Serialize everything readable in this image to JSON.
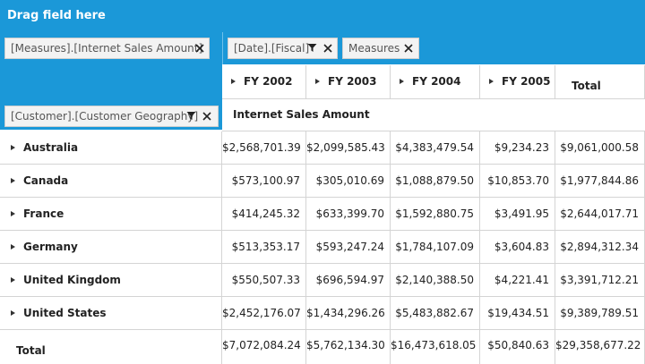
{
  "drag_bar": {
    "label": "Drag field here"
  },
  "values_area": {
    "pill": "[Measures].[Internet Sales Amount]"
  },
  "columns_area": {
    "pills": [
      "[Date].[Fiscal]",
      "Measures"
    ]
  },
  "rows_area": {
    "pill": "[Customer].[Customer Geography]"
  },
  "column_headers": [
    "FY 2002",
    "FY 2003",
    "FY 2004",
    "FY 2005",
    "Total"
  ],
  "measure_label": "Internet Sales Amount",
  "rows": [
    {
      "label": "Australia",
      "values": [
        "$2,568,701.39",
        "$2,099,585.43",
        "$4,383,479.54",
        "$9,234.23",
        "$9,061,000.58"
      ]
    },
    {
      "label": "Canada",
      "values": [
        "$573,100.97",
        "$305,010.69",
        "$1,088,879.50",
        "$10,853.70",
        "$1,977,844.86"
      ]
    },
    {
      "label": "France",
      "values": [
        "$414,245.32",
        "$633,399.70",
        "$1,592,880.75",
        "$3,491.95",
        "$2,644,017.71"
      ]
    },
    {
      "label": "Germany",
      "values": [
        "$513,353.17",
        "$593,247.24",
        "$1,784,107.09",
        "$3,604.83",
        "$2,894,312.34"
      ]
    },
    {
      "label": "United Kingdom",
      "values": [
        "$550,507.33",
        "$696,594.97",
        "$2,140,388.50",
        "$4,221.41",
        "$3,391,712.21"
      ]
    },
    {
      "label": "United States",
      "values": [
        "$2,452,176.07",
        "$1,434,296.26",
        "$5,483,882.67",
        "$19,434.51",
        "$9,389,789.51"
      ]
    }
  ],
  "total_row": {
    "label": "Total",
    "values": [
      "$7,072,084.24",
      "$5,762,134.30",
      "$16,473,618.05",
      "$50,840.63",
      "$29,358,677.22"
    ]
  },
  "colors": {
    "accent": "#1b98d8",
    "grid_line": "#d4d4d4",
    "pill_bg": "#f3f3f3"
  },
  "icons": {
    "remove": "close-icon",
    "filter": "filter-icon",
    "expand": "expand-triangle-icon"
  }
}
